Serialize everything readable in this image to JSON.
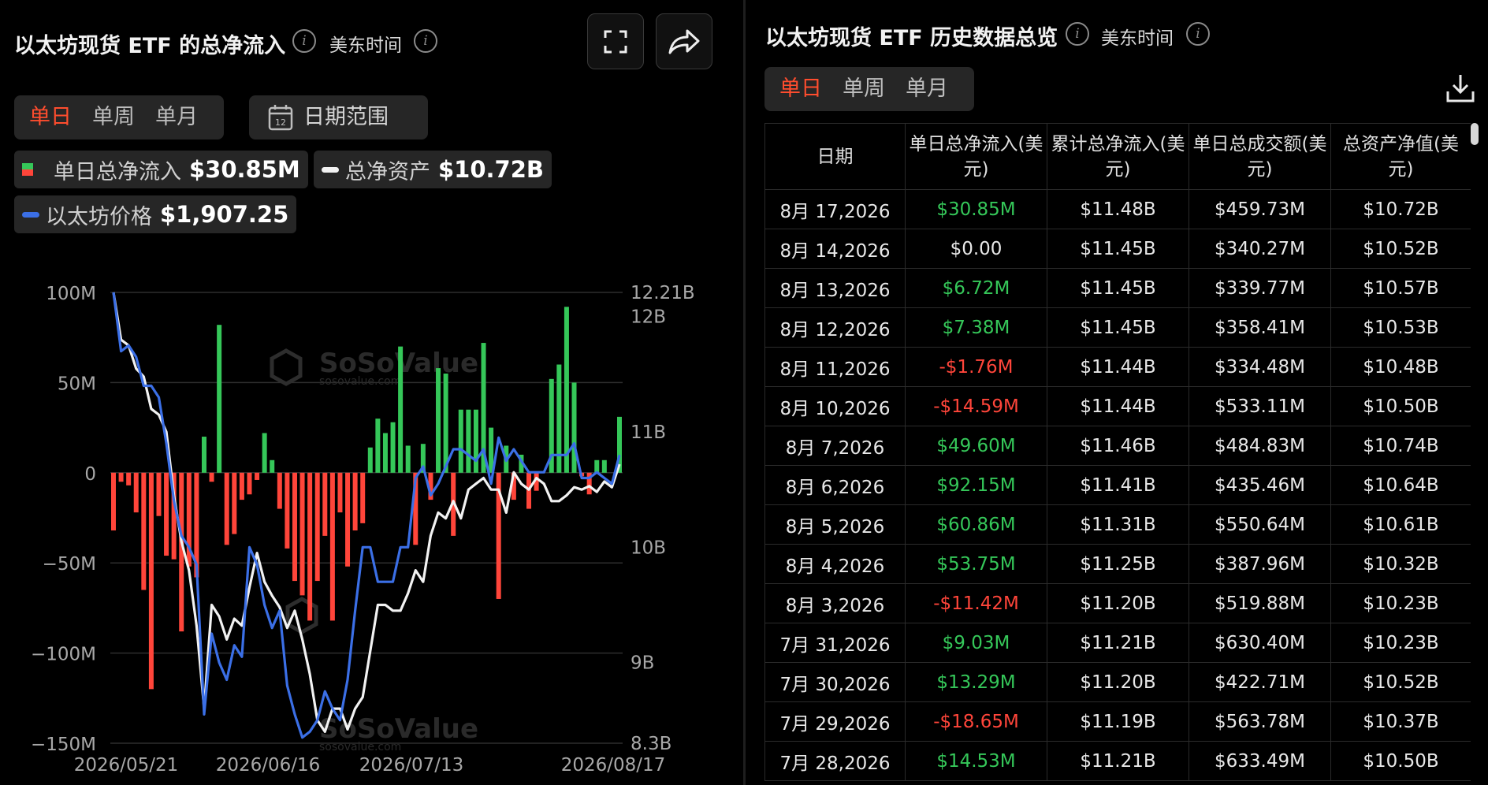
{
  "left": {
    "title": "以太坊现货 ETF 的总净流入",
    "time_label": "美东时间",
    "tabs": [
      "单日",
      "单周",
      "单月"
    ],
    "active_tab": 0,
    "date_range_label": "日期范围",
    "legend": [
      {
        "label": "单日总净流入",
        "value": "$30.85M"
      },
      {
        "label": "总净资产",
        "value": "$10.72B"
      },
      {
        "label": "以太坊价格",
        "value": "$1,907.25"
      }
    ],
    "watermark": "SoSoValue",
    "watermark_url": "sosovalue.com"
  },
  "right": {
    "title": "以太坊现货 ETF 历史数据总览",
    "time_label": "美东时间",
    "tabs": [
      "单日",
      "单周",
      "单月"
    ],
    "active_tab": 0,
    "columns": [
      "日期",
      "单日总净流入(美元)",
      "累计总净流入(美元)",
      "单日总成交额(美元)",
      "总资产净值(美元)"
    ],
    "rows": [
      {
        "date": "8月 17,2026",
        "flow": "$30.85M",
        "sign": "pos",
        "cum": "$11.48B",
        "vol": "$459.73M",
        "nav": "$10.72B"
      },
      {
        "date": "8月 14,2026",
        "flow": "$0.00",
        "sign": "zero",
        "cum": "$11.45B",
        "vol": "$340.27M",
        "nav": "$10.52B"
      },
      {
        "date": "8月 13,2026",
        "flow": "$6.72M",
        "sign": "pos",
        "cum": "$11.45B",
        "vol": "$339.77M",
        "nav": "$10.57B"
      },
      {
        "date": "8月 12,2026",
        "flow": "$7.38M",
        "sign": "pos",
        "cum": "$11.45B",
        "vol": "$358.41M",
        "nav": "$10.53B"
      },
      {
        "date": "8月 11,2026",
        "flow": "-$1.76M",
        "sign": "neg",
        "cum": "$11.44B",
        "vol": "$334.48M",
        "nav": "$10.48B"
      },
      {
        "date": "8月 10,2026",
        "flow": "-$14.59M",
        "sign": "neg",
        "cum": "$11.44B",
        "vol": "$533.11M",
        "nav": "$10.50B"
      },
      {
        "date": "8月 7,2026",
        "flow": "$49.60M",
        "sign": "pos",
        "cum": "$11.46B",
        "vol": "$484.83M",
        "nav": "$10.74B"
      },
      {
        "date": "8月 6,2026",
        "flow": "$92.15M",
        "sign": "pos",
        "cum": "$11.41B",
        "vol": "$435.46M",
        "nav": "$10.64B"
      },
      {
        "date": "8月 5,2026",
        "flow": "$60.86M",
        "sign": "pos",
        "cum": "$11.31B",
        "vol": "$550.64M",
        "nav": "$10.61B"
      },
      {
        "date": "8月 4,2026",
        "flow": "$53.75M",
        "sign": "pos",
        "cum": "$11.25B",
        "vol": "$387.96M",
        "nav": "$10.32B"
      },
      {
        "date": "8月 3,2026",
        "flow": "-$11.42M",
        "sign": "neg",
        "cum": "$11.20B",
        "vol": "$519.88M",
        "nav": "$10.23B"
      },
      {
        "date": "7月 31,2026",
        "flow": "$9.03M",
        "sign": "pos",
        "cum": "$11.21B",
        "vol": "$630.40M",
        "nav": "$10.23B"
      },
      {
        "date": "7月 30,2026",
        "flow": "$13.29M",
        "sign": "pos",
        "cum": "$11.20B",
        "vol": "$422.71M",
        "nav": "$10.52B"
      },
      {
        "date": "7月 29,2026",
        "flow": "-$18.65M",
        "sign": "neg",
        "cum": "$11.19B",
        "vol": "$563.78M",
        "nav": "$10.37B"
      },
      {
        "date": "7月 28,2026",
        "flow": "$14.53M",
        "sign": "pos",
        "cum": "$11.21B",
        "vol": "$633.49M",
        "nav": "$10.50B"
      }
    ]
  },
  "colors": {
    "positive": "#35c759",
    "negative": "#ff453a",
    "price_line": "#3b6fe6",
    "nav_line": "#f2f2f2",
    "active_tab": "#ff4d2e"
  },
  "chart_data": {
    "type": "bar",
    "x_ticks": [
      "2026/05/21",
      "2026/06/16",
      "2026/07/13",
      "2026/08/17"
    ],
    "y_left_ticks": [
      "100M",
      "50M",
      "0",
      "−50M",
      "−100M",
      "−150M"
    ],
    "y_left_range": [
      -150,
      100
    ],
    "y_left_unit": "M",
    "y_right_ticks": [
      "12.21B",
      "12B",
      "11B",
      "10B",
      "9B",
      "8.3B"
    ],
    "y_right_range": [
      8.3,
      12.21
    ],
    "y_right_unit": "B",
    "grid": true,
    "series": [
      {
        "name": "单日总净流入",
        "type": "bar",
        "values": [
          -32,
          -5,
          -7,
          -22,
          -65,
          -120,
          -24,
          -46,
          -48,
          -88,
          -52,
          -58,
          20,
          -5,
          82,
          -40,
          -34,
          -15,
          -12,
          -4,
          22,
          7,
          -20,
          -42,
          -60,
          -68,
          -82,
          -60,
          -35,
          -82,
          -22,
          -52,
          -32,
          -28,
          14,
          30,
          22,
          28,
          70,
          15,
          -40,
          16,
          -15,
          58,
          55,
          -35,
          35,
          35,
          35,
          72,
          25,
          -70,
          15,
          -15,
          10,
          -20,
          -10,
          0,
          52,
          60,
          92,
          50,
          -2,
          -12,
          7,
          7,
          0,
          31
        ]
      },
      {
        "name": "总净资产",
        "type": "line",
        "axis": "right",
        "values": [
          12.21,
          11.8,
          11.75,
          11.55,
          11.48,
          11.2,
          11.15,
          11.0,
          10.45,
          10.05,
          9.8,
          9.32,
          8.6,
          9.5,
          9.4,
          9.2,
          9.38,
          9.32,
          9.65,
          9.95,
          9.7,
          9.58,
          9.48,
          9.3,
          9.45,
          9.2,
          8.9,
          8.5,
          8.4,
          8.6,
          8.6,
          8.42,
          8.6,
          8.7,
          9.1,
          9.5,
          9.5,
          9.45,
          9.45,
          9.6,
          9.8,
          9.7,
          10.1,
          10.3,
          10.25,
          10.4,
          10.25,
          10.5,
          10.55,
          10.6,
          10.5,
          10.5,
          10.3,
          10.65,
          10.55,
          10.5,
          10.6,
          10.55,
          10.4,
          10.4,
          10.45,
          10.52,
          10.5,
          10.53,
          10.48,
          10.57,
          10.52,
          10.72
        ]
      },
      {
        "name": "以太坊价格",
        "type": "line",
        "axis": "right",
        "values": [
          12.21,
          11.7,
          11.75,
          11.65,
          11.4,
          11.4,
          11.3,
          10.9,
          10.4,
          10.1,
          10.0,
          9.85,
          8.55,
          9.25,
          9.0,
          8.85,
          9.15,
          9.05,
          10.0,
          9.85,
          9.5,
          9.3,
          9.45,
          8.8,
          8.55,
          8.35,
          8.4,
          8.5,
          8.75,
          8.6,
          8.5,
          8.85,
          9.45,
          10.0,
          10.0,
          9.7,
          9.7,
          9.7,
          10.0,
          10.0,
          10.6,
          10.7,
          10.45,
          10.55,
          10.7,
          10.85,
          10.85,
          10.8,
          10.75,
          10.85,
          10.55,
          10.95,
          10.75,
          10.85,
          10.75,
          10.65,
          10.65,
          10.65,
          10.8,
          10.8,
          10.8,
          10.9,
          10.6,
          10.6,
          10.65,
          10.6,
          10.55,
          10.8
        ]
      }
    ]
  }
}
